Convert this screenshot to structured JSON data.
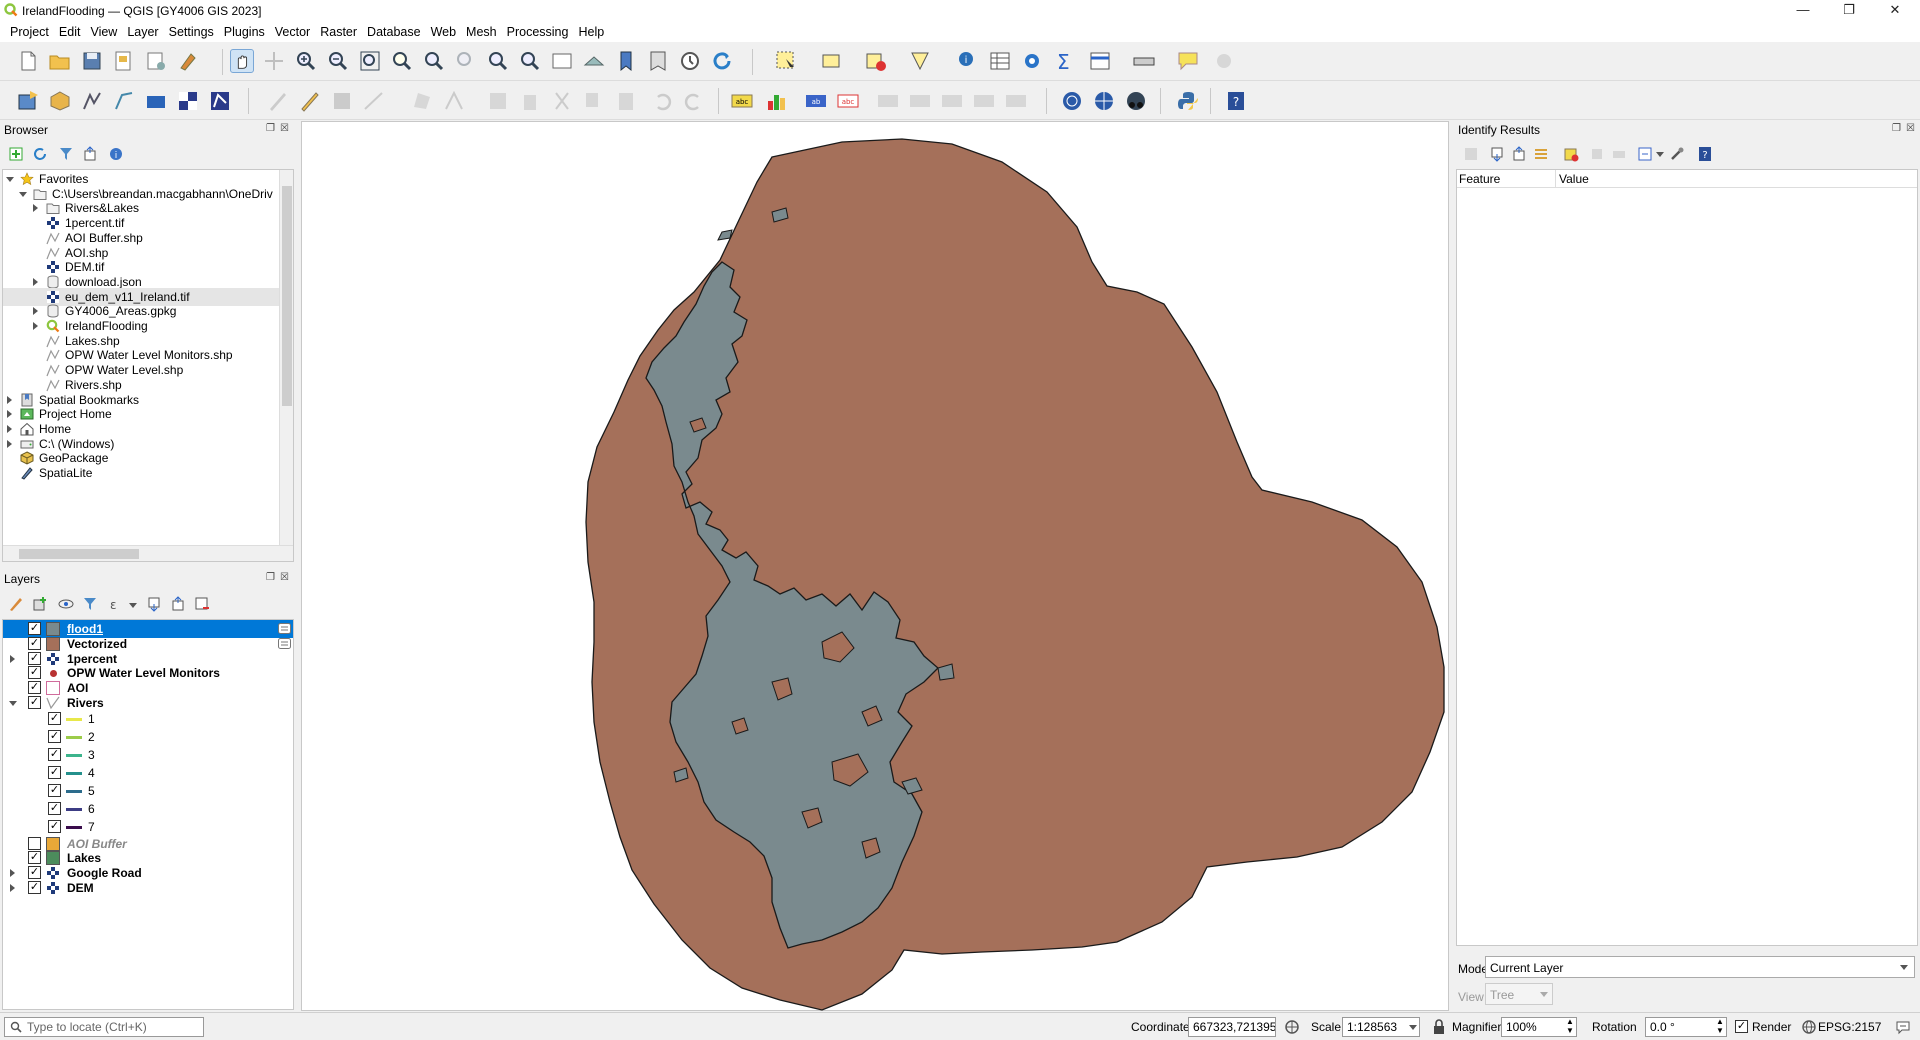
{
  "window": {
    "title": "IrelandFlooding — QGIS [GY4006 GIS 2023]"
  },
  "menu": [
    "Project",
    "Edit",
    "View",
    "Layer",
    "Settings",
    "Plugins",
    "Vector",
    "Raster",
    "Database",
    "Web",
    "Mesh",
    "Processing",
    "Help"
  ],
  "browser": {
    "title": "Browser",
    "items": [
      {
        "label": "Favorites",
        "icon": "star-icon"
      },
      {
        "label": "C:\\Users\\breandan.macgabhann\\OneDriv",
        "icon": "folder-icon"
      },
      {
        "label": "Rivers&Lakes",
        "icon": "folder-icon"
      },
      {
        "label": "1percent.tif",
        "icon": "raster-icon"
      },
      {
        "label": "AOI Buffer.shp",
        "icon": "vector-icon"
      },
      {
        "label": "AOI.shp",
        "icon": "vector-icon"
      },
      {
        "label": "DEM.tif",
        "icon": "raster-icon"
      },
      {
        "label": "download.json",
        "icon": "database-icon"
      },
      {
        "label": "eu_dem_v11_Ireland.tif",
        "icon": "raster-icon"
      },
      {
        "label": "GY4006_Areas.gpkg",
        "icon": "database-icon"
      },
      {
        "label": "IrelandFlooding",
        "icon": "qgis-icon"
      },
      {
        "label": "Lakes.shp",
        "icon": "vector-icon"
      },
      {
        "label": "OPW Water Level Monitors.shp",
        "icon": "vector-icon"
      },
      {
        "label": "OPW Water Level.shp",
        "icon": "vector-icon"
      },
      {
        "label": "Rivers.shp",
        "icon": "vector-icon"
      },
      {
        "label": "Spatial Bookmarks",
        "icon": "bookmark-icon"
      },
      {
        "label": "Project Home",
        "icon": "project-home-icon"
      },
      {
        "label": "Home",
        "icon": "home-icon"
      },
      {
        "label": "C:\\ (Windows)",
        "icon": "drive-icon"
      },
      {
        "label": "GeoPackage",
        "icon": "geopackage-icon"
      },
      {
        "label": "SpatiaLite",
        "icon": "spatialite-icon"
      }
    ]
  },
  "layers": {
    "title": "Layers",
    "items": [
      {
        "label": "flood1",
        "checked": true,
        "color": "#7a8a8e",
        "selected": true
      },
      {
        "label": "Vectorized",
        "checked": true,
        "color": "#a5705a"
      },
      {
        "label": "1percent",
        "checked": true,
        "icon": "raster-icon"
      },
      {
        "label": "OPW Water Level Monitors",
        "checked": true,
        "icon": "point-icon",
        "color": "#b83232"
      },
      {
        "label": "AOI",
        "checked": true,
        "color": "#ffffff",
        "outline": "#d06c9c"
      },
      {
        "label": "Rivers",
        "checked": true,
        "icon": "line-icon"
      },
      {
        "label": "1",
        "checked": true,
        "line": "#e8e84a"
      },
      {
        "label": "2",
        "checked": true,
        "line": "#9ccc4a"
      },
      {
        "label": "3",
        "checked": true,
        "line": "#3cb48c"
      },
      {
        "label": "4",
        "checked": true,
        "line": "#24908c"
      },
      {
        "label": "5",
        "checked": true,
        "line": "#2c6c8c"
      },
      {
        "label": "6",
        "checked": true,
        "line": "#3c3c84"
      },
      {
        "label": "7",
        "checked": true,
        "line": "#3a0c4c"
      },
      {
        "label": "AOI Buffer",
        "checked": false,
        "color": "#e8a838"
      },
      {
        "label": "Lakes",
        "checked": true,
        "color": "#4c8c5c"
      },
      {
        "label": "Google Road",
        "checked": true,
        "icon": "raster-icon"
      },
      {
        "label": "DEM",
        "checked": true,
        "icon": "raster-icon"
      }
    ]
  },
  "identify": {
    "title": "Identify Results",
    "columns": [
      "Feature",
      "Value"
    ],
    "mode_label": "Mode",
    "mode_value": "Current Layer",
    "view_label": "View",
    "view_value": "Tree"
  },
  "status": {
    "locate_placeholder": "Type to locate (Ctrl+K)",
    "coordinate_label": "Coordinate",
    "coordinate_value": "667323,721395",
    "scale_label": "Scale",
    "scale_value": "1:128563",
    "magnifier_label": "Magnifier",
    "magnifier_value": "100%",
    "rotation_label": "Rotation",
    "rotation_value": "0.0 °",
    "render_label": "Render",
    "crs_label": "EPSG:2157"
  },
  "colors": {
    "vectorized_fill": "#a5705a",
    "flood_fill": "#7a8a8e",
    "selection": "#0078d7"
  }
}
